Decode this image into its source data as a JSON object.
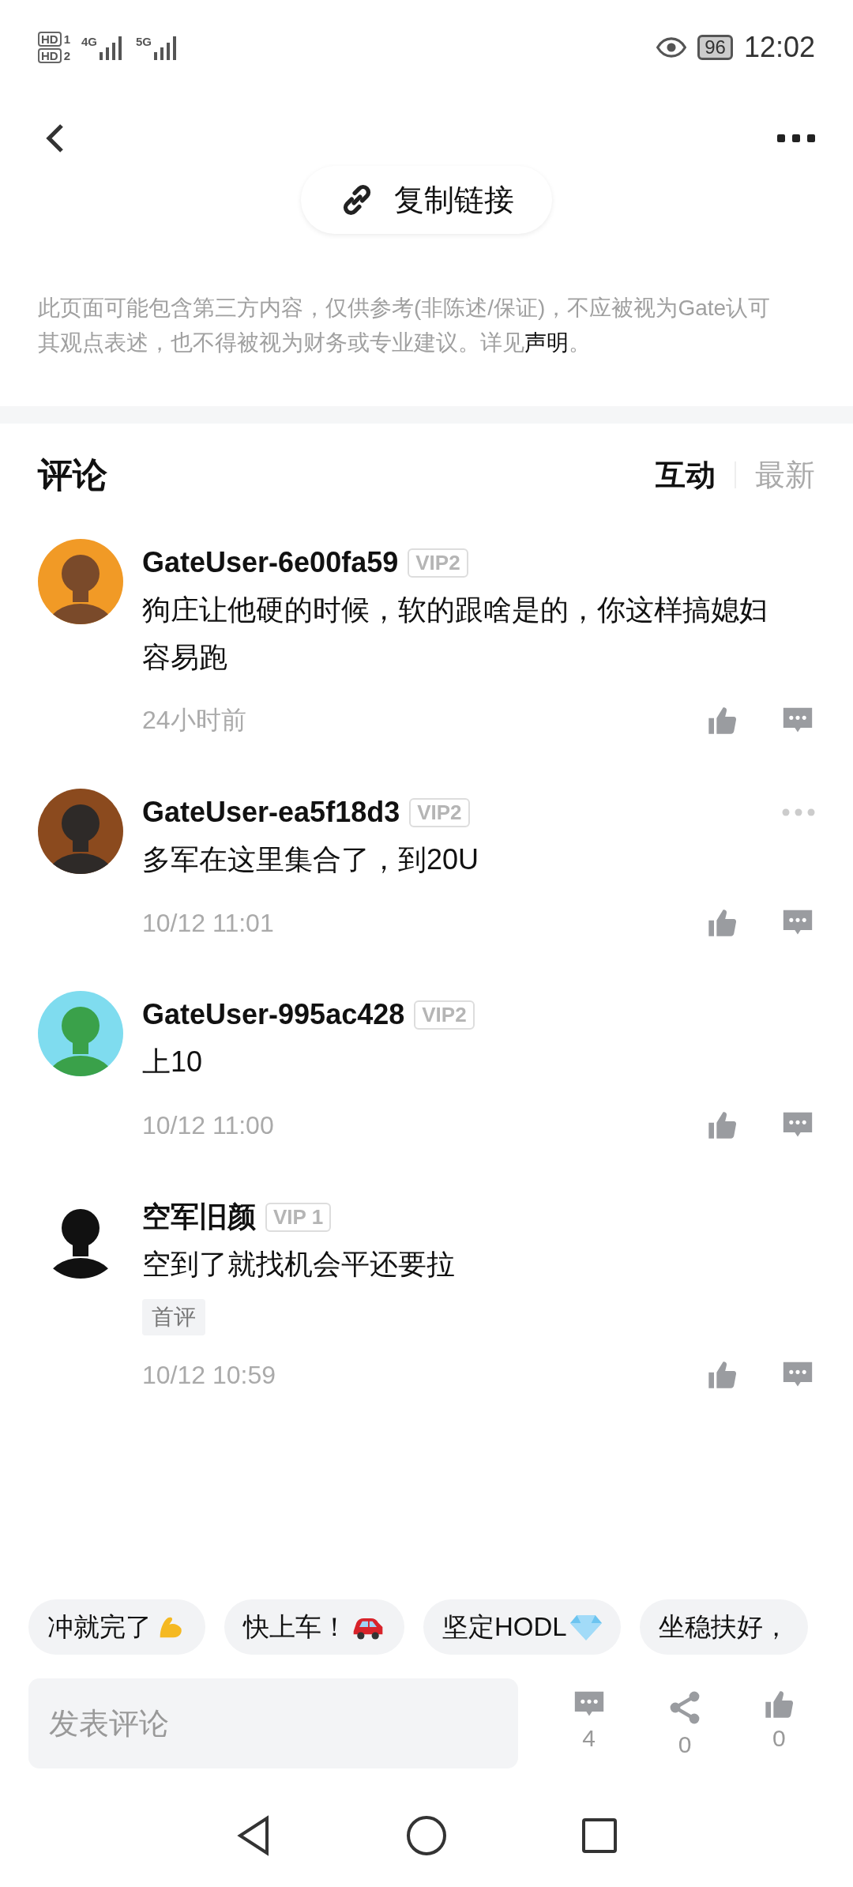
{
  "status_bar": {
    "sims": [
      {
        "label": "HD",
        "slot": "1"
      },
      {
        "label": "HD",
        "slot": "2"
      }
    ],
    "networks": [
      "4G",
      "5G"
    ],
    "battery": "96",
    "time": "12:02"
  },
  "copy_link": {
    "label": "复制链接"
  },
  "disclaimer": {
    "text": "此页面可能包含第三方内容，仅供参考(非陈述/保证)，不应被视为Gate认可其观点表述，也不得被视为财务或专业建议。详见",
    "link": "声明",
    "end": "。"
  },
  "comments_header": {
    "title": "评论",
    "tabs": [
      {
        "label": "互动",
        "selected": true
      },
      {
        "label": "最新",
        "selected": false
      }
    ]
  },
  "comments": [
    {
      "user": "GateUser-6e00fa59",
      "vip": "VIP2",
      "text": "狗庄让他硬的时候，软的跟啥是的，你这样搞媳妇容易跑",
      "time": "24小时前",
      "menu": false
    },
    {
      "user": "GateUser-ea5f18d3",
      "vip": "VIP2",
      "text": "多军在这里集合了，到20U",
      "time": "10/12 11:01",
      "menu": true
    },
    {
      "user": "GateUser-995ac428",
      "vip": "VIP2",
      "text": "上10",
      "time": "10/12 11:00",
      "menu": false
    },
    {
      "user": "空军旧颜",
      "vip": "VIP 1",
      "text": "空到了就找机会平还要拉",
      "tag": "首评",
      "time": "10/12 10:59",
      "menu": false
    }
  ],
  "quick_replies": [
    {
      "label": "冲就完了",
      "kind": "arm"
    },
    {
      "label": "快上车！",
      "kind": "car"
    },
    {
      "label": "坚定HODL",
      "kind": "gem"
    },
    {
      "label": "坐稳扶好，",
      "kind": "plain"
    }
  ],
  "comment_input": {
    "placeholder": "发表评论"
  },
  "actions": [
    {
      "kind": "comment",
      "count": "4"
    },
    {
      "kind": "share",
      "count": "0"
    },
    {
      "kind": "like",
      "count": "0"
    }
  ]
}
